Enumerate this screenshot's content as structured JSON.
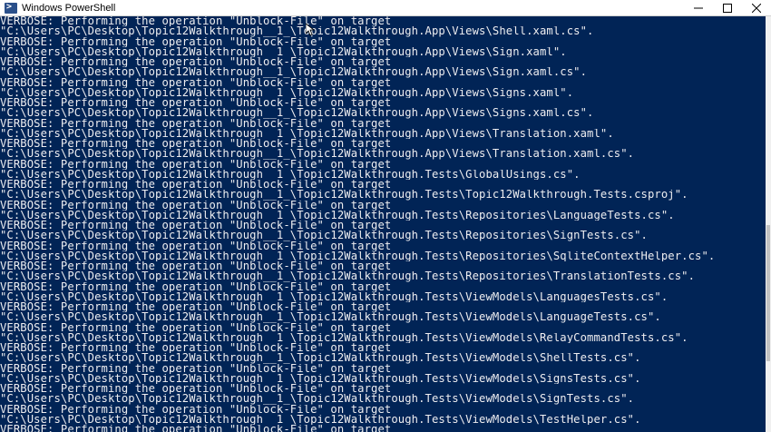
{
  "window": {
    "title": "Windows PowerShell",
    "icon_name": "powershell-icon"
  },
  "colors": {
    "console_background": "#012456",
    "console_text": "#eeedf0",
    "selection_background": "#ecebe6"
  },
  "console": {
    "lines": [
      "VERBOSE: Performing the operation \"Unblock-File\" on target",
      "\"C:\\Users\\PC\\Desktop\\Topic12Walkthrough__1_\\Topic12Walkthrough.App\\Views\\Shell.xaml.cs\".",
      "VERBOSE: Performing the operation \"Unblock-File\" on target",
      "\"C:\\Users\\PC\\Desktop\\Topic12Walkthrough__1_\\Topic12Walkthrough.App\\Views\\Sign.xaml\".",
      "VERBOSE: Performing the operation \"Unblock-File\" on target",
      "\"C:\\Users\\PC\\Desktop\\Topic12Walkthrough__1_\\Topic12Walkthrough.App\\Views\\Sign.xaml.cs\".",
      "VERBOSE: Performing the operation \"Unblock-File\" on target",
      "\"C:\\Users\\PC\\Desktop\\Topic12Walkthrough__1_\\Topic12Walkthrough.App\\Views\\Signs.xaml\".",
      "VERBOSE: Performing the operation \"Unblock-File\" on target",
      "\"C:\\Users\\PC\\Desktop\\Topic12Walkthrough__1_\\Topic12Walkthrough.App\\Views\\Signs.xaml.cs\".",
      "VERBOSE: Performing the operation \"Unblock-File\" on target",
      "\"C:\\Users\\PC\\Desktop\\Topic12Walkthrough__1_\\Topic12Walkthrough.App\\Views\\Translation.xaml\".",
      "VERBOSE: Performing the operation \"Unblock-File\" on target",
      "\"C:\\Users\\PC\\Desktop\\Topic12Walkthrough__1_\\Topic12Walkthrough.App\\Views\\Translation.xaml.cs\".",
      "VERBOSE: Performing the operation \"Unblock-File\" on target",
      "\"C:\\Users\\PC\\Desktop\\Topic12Walkthrough__1_\\Topic12Walkthrough.Tests\\GlobalUsings.cs\".",
      "VERBOSE: Performing the operation \"Unblock-File\" on target",
      "\"C:\\Users\\PC\\Desktop\\Topic12Walkthrough__1_\\Topic12Walkthrough.Tests\\Topic12Walkthrough.Tests.csproj\".",
      "VERBOSE: Performing the operation \"Unblock-File\" on target",
      "\"C:\\Users\\PC\\Desktop\\Topic12Walkthrough__1_\\Topic12Walkthrough.Tests\\Repositories\\LanguageTests.cs\".",
      "VERBOSE: Performing the operation \"Unblock-File\" on target",
      "\"C:\\Users\\PC\\Desktop\\Topic12Walkthrough__1_\\Topic12Walkthrough.Tests\\Repositories\\SignTests.cs\".",
      "VERBOSE: Performing the operation \"Unblock-File\" on target",
      "\"C:\\Users\\PC\\Desktop\\Topic12Walkthrough__1_\\Topic12Walkthrough.Tests\\Repositories\\SqliteContextHelper.cs\".",
      "VERBOSE: Performing the operation \"Unblock-File\" on target",
      "\"C:\\Users\\PC\\Desktop\\Topic12Walkthrough__1_\\Topic12Walkthrough.Tests\\Repositories\\TranslationTests.cs\".",
      "VERBOSE: Performing the operation \"Unblock-File\" on target",
      "\"C:\\Users\\PC\\Desktop\\Topic12Walkthrough__1_\\Topic12Walkthrough.Tests\\ViewModels\\LanguagesTests.cs\".",
      "VERBOSE: Performing the operation \"Unblock-File\" on target",
      "\"C:\\Users\\PC\\Desktop\\Topic12Walkthrough__1_\\Topic12Walkthrough.Tests\\ViewModels\\LanguageTests.cs\".",
      "VERBOSE: Performing the operation \"Unblock-File\" on target",
      "\"C:\\Users\\PC\\Desktop\\Topic12Walkthrough__1_\\Topic12Walkthrough.Tests\\ViewModels\\RelayCommandTests.cs\".",
      "VERBOSE: Performing the operation \"Unblock-File\" on target",
      "\"C:\\Users\\PC\\Desktop\\Topic12Walkthrough__1_\\Topic12Walkthrough.Tests\\ViewModels\\ShellTests.cs\".",
      "VERBOSE: Performing the operation \"Unblock-File\" on target",
      "\"C:\\Users\\PC\\Desktop\\Topic12Walkthrough__1_\\Topic12Walkthrough.Tests\\ViewModels\\SignsTests.cs\".",
      "VERBOSE: Performing the operation \"Unblock-File\" on target",
      "\"C:\\Users\\PC\\Desktop\\Topic12Walkthrough__1_\\Topic12Walkthrough.Tests\\ViewModels\\SignTests.cs\".",
      "VERBOSE: Performing the operation \"Unblock-File\" on target",
      "\"C:\\Users\\PC\\Desktop\\Topic12Walkthrough__1_\\Topic12Walkthrough.Tests\\ViewModels\\TestHelper.cs\".",
      "VERBOSE: Performing the operation \"Unblock-File\" on target"
    ]
  }
}
